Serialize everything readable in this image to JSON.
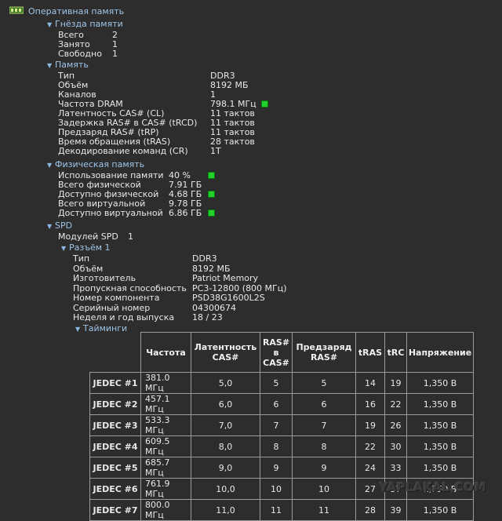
{
  "root": {
    "label": "Оперативная память",
    "icon": "ram-module-icon"
  },
  "slots": {
    "label": "Гнёзда памяти",
    "items": [
      {
        "name": "Всего",
        "value": "2"
      },
      {
        "name": "Занято",
        "value": "1"
      },
      {
        "name": "Свободно",
        "value": "1"
      }
    ]
  },
  "memory": {
    "label": "Память",
    "items": [
      {
        "name": "Тип",
        "value": "DDR3"
      },
      {
        "name": "Объём",
        "value": "8192 МБ"
      },
      {
        "name": "Каналов",
        "value": "1"
      },
      {
        "name": "Частота DRAM",
        "value": "798.1 МГц"
      },
      {
        "name": "Латентность CAS# (CL)",
        "value": "11 тактов"
      },
      {
        "name": "Задержка RAS# в CAS# (tRCD)",
        "value": "11 тактов"
      },
      {
        "name": "Предзаряд RAS# (tRP)",
        "value": "11 тактов"
      },
      {
        "name": "Время обращения (tRAS)",
        "value": "28 тактов"
      },
      {
        "name": "Декодирование команд (CR)",
        "value": "1T"
      }
    ]
  },
  "physical": {
    "label": "Физическая память",
    "items": [
      {
        "name": "Использование памяти",
        "value": "40 %"
      },
      {
        "name": "Всего физической",
        "value": "7.91 ГБ"
      },
      {
        "name": "Доступно физической",
        "value": "4.68 ГБ"
      },
      {
        "name": "Всего виртуальной",
        "value": "9.78 ГБ"
      },
      {
        "name": "Доступно виртуальной",
        "value": "6.86 ГБ"
      }
    ]
  },
  "spd": {
    "label": "SPD",
    "modules_label": "Модулей SPD",
    "modules_value": "1",
    "slot": {
      "label": "Разъём 1",
      "items": [
        {
          "name": "Тип",
          "value": "DDR3"
        },
        {
          "name": "Объём",
          "value": "8192 МБ"
        },
        {
          "name": "Изготовитель",
          "value": "Patriot Memory"
        },
        {
          "name": "Пропускная способность",
          "value": "PC3-12800 (800 МГц)"
        },
        {
          "name": "Номер компонента",
          "value": "PSD38G1600L2S"
        },
        {
          "name": "Серийный номер",
          "value": "04300674"
        },
        {
          "name": "Неделя и год выпуска",
          "value": "18 / 23"
        }
      ]
    },
    "timings": {
      "label": "Тайминги",
      "headers": [
        "Частота",
        "Латентность CAS#",
        "RAS# в CAS#",
        "Предзаряд RAS#",
        "tRAS",
        "tRC",
        "Напряжение"
      ],
      "header_lines": [
        [
          "Частота"
        ],
        [
          "Латентность",
          "CAS#"
        ],
        [
          "RAS#",
          "в",
          "CAS#"
        ],
        [
          "Предзаряд",
          "RAS#"
        ],
        [
          "tRAS"
        ],
        [
          "tRC"
        ],
        [
          "Напряжение"
        ]
      ],
      "rows": [
        {
          "name": "JEDEC #1",
          "cells": [
            "381.0 МГц",
            "5,0",
            "5",
            "5",
            "14",
            "19",
            "1,350 В"
          ]
        },
        {
          "name": "JEDEC #2",
          "cells": [
            "457.1 МГц",
            "6,0",
            "6",
            "6",
            "16",
            "22",
            "1,350 В"
          ]
        },
        {
          "name": "JEDEC #3",
          "cells": [
            "533.3 МГц",
            "7,0",
            "7",
            "7",
            "19",
            "26",
            "1,350 В"
          ]
        },
        {
          "name": "JEDEC #4",
          "cells": [
            "609.5 МГц",
            "8,0",
            "8",
            "8",
            "22",
            "30",
            "1,350 В"
          ]
        },
        {
          "name": "JEDEC #5",
          "cells": [
            "685.7 МГц",
            "9,0",
            "9",
            "9",
            "24",
            "33",
            "1,350 В"
          ]
        },
        {
          "name": "JEDEC #6",
          "cells": [
            "761.9 МГц",
            "10,0",
            "10",
            "10",
            "27",
            "37",
            "1,350 В"
          ]
        },
        {
          "name": "JEDEC #7",
          "cells": [
            "800.0 МГц",
            "11,0",
            "11",
            "11",
            "28",
            "39",
            "1,350 В"
          ]
        }
      ]
    }
  },
  "status_led_color": "#23d12d",
  "watermark": "YAPLAKAL.COM"
}
